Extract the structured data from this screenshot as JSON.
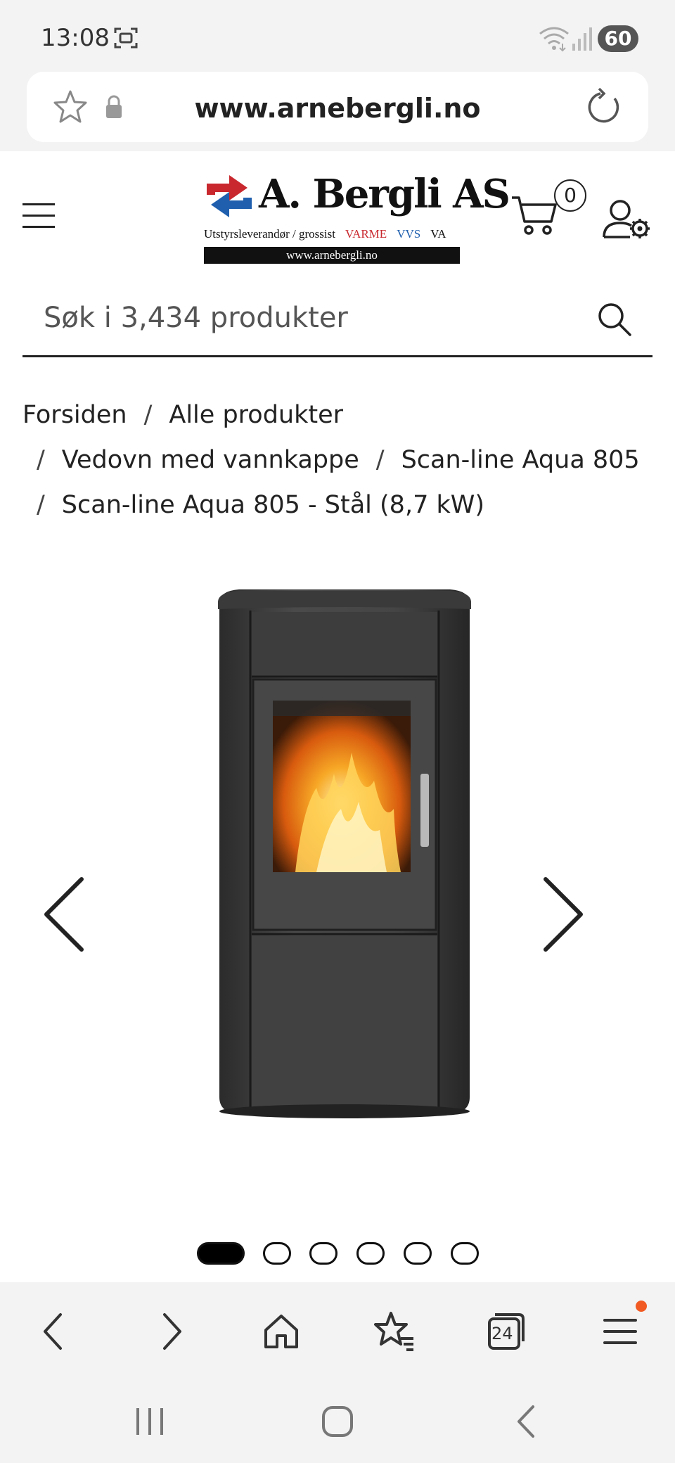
{
  "status_bar": {
    "time": "13:08",
    "battery": "60"
  },
  "browser": {
    "url": "www.arnebergli.no"
  },
  "site": {
    "logo": {
      "name": "A. Bergli AS",
      "tagline": "Utstyrsleverandør / grossist",
      "tag_varme": "VARME",
      "tag_vvs": "VVS",
      "tag_va": "VA",
      "url": "www.arnebergli.no",
      "colors": {
        "red": "#c8282e",
        "blue": "#1f5fae"
      }
    },
    "cart_count": "0",
    "search_placeholder": "Søk i 3,434 produkter"
  },
  "breadcrumb": {
    "items": [
      "Forsiden",
      "Alle produkter",
      "Vedovn med vannkappe",
      "Scan-line Aqua 805",
      "Scan-line Aqua 805 - Stål (8,7 kW)"
    ],
    "separator": "/"
  },
  "gallery": {
    "image_count": 6,
    "active_index": 0
  },
  "bottom_nav": {
    "tabs_count": "24"
  },
  "colors": {
    "accent_notification": "#f15a22",
    "chrome_bg": "#f3f3f3"
  }
}
